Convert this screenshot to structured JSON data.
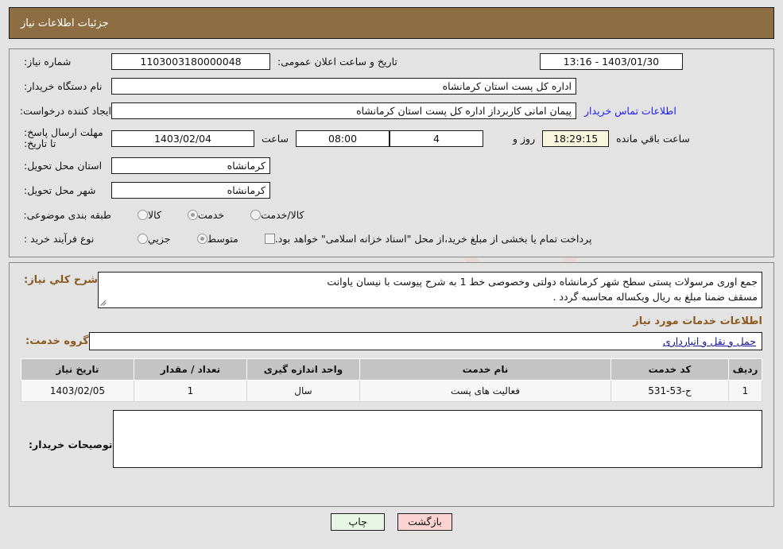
{
  "header": {
    "title": "جزئیات اطلاعات نیاز"
  },
  "watermark": {
    "text": "AnaTender.net",
    "shield_icon": "shield-icon"
  },
  "form": {
    "need_number_label": "شماره نیاز:",
    "need_number_value": "1103003180000048",
    "announce_datetime_label": "تاریخ و ساعت اعلان عمومی:",
    "announce_datetime_value": "1403/01/30 - 13:16",
    "buyer_org_label": "نام دستگاه خریدار:",
    "buyer_org_value": "اداره کل پست استان کرمانشاه",
    "creator_label": "ایجاد کننده درخواست:",
    "creator_value": "پیمان امانی کاربرداز اداره کل پست استان کرمانشاه",
    "contact_link": "اطلاعات تماس خریدار",
    "deadline_label": "مهلت ارسال پاسخ: تا تاریخ:",
    "deadline_date": "1403/02/04",
    "hour_label": "ساعت",
    "deadline_time": "08:00",
    "remaining_days": "4",
    "days_label": "روز و",
    "remaining_clock": "18:29:15",
    "remaining_suffix": "ساعت باقي مانده",
    "province_label": "استان محل تحویل:",
    "province_value": "کرمانشاه",
    "city_label": "شهر محل تحویل:",
    "city_value": "کرمانشاه",
    "category_label": "طبقه بندی موضوعی:",
    "category_options": [
      {
        "label": "کالا",
        "checked": false
      },
      {
        "label": "خدمت",
        "checked": true
      },
      {
        "label": "کالا/خدمت",
        "checked": false
      }
    ],
    "process_label": "نوع فرآیند خرید :",
    "process_options": [
      {
        "label": "جزیي",
        "checked": false
      },
      {
        "label": "متوسط",
        "checked": true
      }
    ],
    "treasury_checkbox_label": "پرداخت تمام یا بخشی از مبلغ خرید،از محل \"اسناد خزانه اسلامی\" خواهد بود.",
    "treasury_checked": false
  },
  "description": {
    "label": "شرح کلي نياز:",
    "line1": "جمع اوری مرسولات پستی سطح شهر کرمانشاه دولتی وخصوصی خط 1 به شرح پیوست با نیسان یاوانت",
    "line2": "مسقف ضمنا مبلغ به ریال ویکساله محاسبه گردد ."
  },
  "services_section": {
    "heading": "اطلاعات خدمات مورد نیاز",
    "group_label": "گروه خدمت:",
    "group_value": "حمل و نقل و انبارداری"
  },
  "table": {
    "columns": [
      "ردیف",
      "کد خدمت",
      "نام خدمت",
      "واحد اندازه گیری",
      "تعداد / مقدار",
      "تاریخ نیاز"
    ],
    "rows": [
      {
        "radif": "1",
        "code": "ح-53-531",
        "name": "فعالیت های پست",
        "unit": "سال",
        "qty": "1",
        "date": "1403/02/05"
      }
    ]
  },
  "comments": {
    "label": "توصیحات خریدار:",
    "value": ""
  },
  "footer": {
    "print_label": "چاپ",
    "back_label": "بازگشت"
  },
  "colors": {
    "header_brown": "#8d6e43",
    "section_brown": "#8a5a20",
    "link_blue": "#1d1df0",
    "back_pink": "#fbd3d3",
    "print_green": "#e8f6e6",
    "countdown_yellow": "#f7f6dd"
  }
}
